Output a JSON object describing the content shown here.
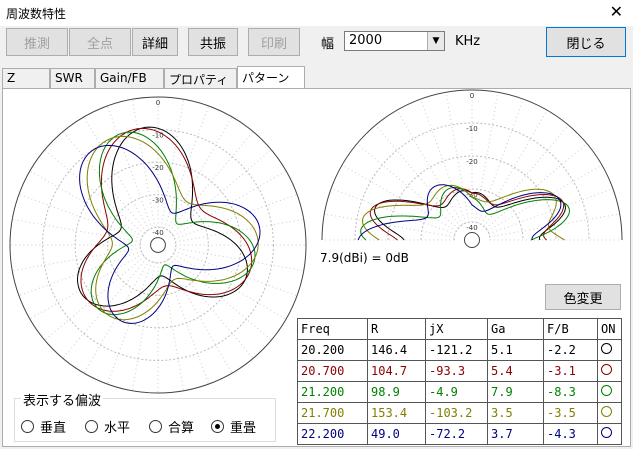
{
  "window": {
    "title": "周波数特性",
    "close": "✕"
  },
  "toolbar": {
    "buttons": [
      {
        "name": "estimate-button",
        "label": "推測",
        "enabled": false
      },
      {
        "name": "all-points-button",
        "label": "全点",
        "enabled": false
      },
      {
        "name": "detail-button",
        "label": "詳細",
        "enabled": true
      },
      {
        "name": "resonance-button",
        "label": "共振",
        "enabled": true
      },
      {
        "name": "print-button",
        "label": "印刷",
        "enabled": false
      }
    ],
    "width_label": "幅",
    "width_value": "2000",
    "unit": "KHz",
    "close_label": "閉じる"
  },
  "tabs": [
    {
      "label": "Z",
      "active": false
    },
    {
      "label": "SWR",
      "active": false
    },
    {
      "label": "Gain/FB",
      "active": false
    },
    {
      "label": "プロパティ",
      "active": false
    },
    {
      "label": "パターン",
      "active": true
    }
  ],
  "pattern": {
    "scale_note": "7.9(dBi) = 0dB",
    "color_change": "色変更",
    "ring_labels": [
      "0",
      "-10",
      "-20",
      "-30",
      "-40"
    ]
  },
  "table": {
    "headers": [
      "Freq",
      "R",
      "jX",
      "Ga",
      "F/B",
      "ON"
    ],
    "rows": [
      {
        "freq": "20.200",
        "r": "146.4",
        "jx": "-121.2",
        "ga": "5.1",
        "fb": "-2.2",
        "color": "#000000"
      },
      {
        "freq": "20.700",
        "r": "104.7",
        "jx": "-93.3",
        "ga": "5.4",
        "fb": "-3.1",
        "color": "#8b0000"
      },
      {
        "freq": "21.200",
        "r": "98.9",
        "jx": "-4.9",
        "ga": "7.9",
        "fb": "-8.3",
        "color": "#008000"
      },
      {
        "freq": "21.700",
        "r": "153.4",
        "jx": "-103.2",
        "ga": "3.5",
        "fb": "-3.5",
        "color": "#808000"
      },
      {
        "freq": "22.200",
        "r": "49.0",
        "jx": "-72.2",
        "ga": "3.7",
        "fb": "-4.3",
        "color": "#000080"
      }
    ]
  },
  "polarization": {
    "title": "表示する偏波",
    "options": [
      {
        "label": "垂直",
        "selected": false
      },
      {
        "label": "水平",
        "selected": false
      },
      {
        "label": "合算",
        "selected": false
      },
      {
        "label": "重畳",
        "selected": true
      }
    ]
  }
}
